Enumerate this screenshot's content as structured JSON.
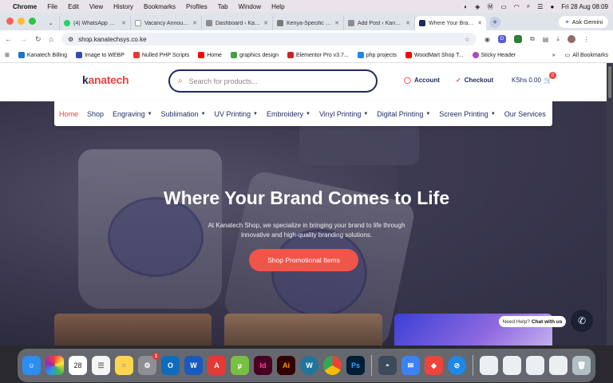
{
  "menubar": {
    "app": "Chrome",
    "items": [
      "File",
      "Edit",
      "View",
      "History",
      "Bookmarks",
      "Profiles",
      "Tab",
      "Window",
      "Help"
    ],
    "datetime": "Fri 28 Aug  08:09"
  },
  "tabs": [
    {
      "title": "(4) WhatsApp Busin",
      "color": "#25d366"
    },
    {
      "title": "Vacancy Announce",
      "color": "#ffffff"
    },
    {
      "title": "Dashboard ‹ Kanate",
      "color": "#8c8c8c"
    },
    {
      "title": "Kenya-Specific SEO",
      "color": "#7a7a7a"
    },
    {
      "title": "Add Post ‹ Kanatec",
      "color": "#8c8c8c"
    },
    {
      "title": "Where Your Brand C",
      "color": "#1f2a5c",
      "active": true
    }
  ],
  "gemini": "Ask Gemini",
  "toolbar": {
    "url": "shop.kanatechsys.co.ke"
  },
  "bookmarks": [
    {
      "label": "Kanatech Billing",
      "color": "#1976d2"
    },
    {
      "label": "Image to WEBP",
      "color": "#3949ab"
    },
    {
      "label": "Nulled PHP Scripts",
      "color": "#e53935"
    },
    {
      "label": "Home",
      "color": "#ff0000"
    },
    {
      "label": "graphics design",
      "color": "#43a047"
    },
    {
      "label": "Elementor Pro v3.7...",
      "color": "#c62828"
    },
    {
      "label": "php projects",
      "color": "#1e88e5"
    },
    {
      "label": "WoodMart Shop T...",
      "color": "#ff0000"
    },
    {
      "label": "Sticky Header",
      "color": "#ab47bc"
    }
  ],
  "bookmarks_all": "All Bookmarks",
  "site": {
    "logo_k": "k",
    "logo_rest": "anatech",
    "search_placeholder": "Search for products...",
    "account": "Account",
    "checkout": "Checkout",
    "cart_total": "KShs 0.00",
    "cart_count": "0"
  },
  "nav": [
    {
      "label": "Home",
      "active": true,
      "dropdown": false
    },
    {
      "label": "Shop",
      "dropdown": false
    },
    {
      "label": "Engraving",
      "dropdown": true
    },
    {
      "label": "Sublimation",
      "dropdown": true
    },
    {
      "label": "UV Printing",
      "dropdown": true
    },
    {
      "label": "Embroidery",
      "dropdown": true
    },
    {
      "label": "Vinyl Printing",
      "dropdown": true
    },
    {
      "label": "Digital Printing",
      "dropdown": true
    },
    {
      "label": "Screen Printing",
      "dropdown": true
    },
    {
      "label": "Our Services",
      "dropdown": false
    }
  ],
  "hero": {
    "title": "Where Your Brand Comes to Life",
    "subtitle": "At Kanatech Shop, we specialize in bringing your brand to life through innovative and high-quality branding solutions.",
    "cta": "Shop Promotional Items"
  },
  "chat": {
    "prefix": "Need Help?",
    "action": "Chat with us"
  },
  "dock": {
    "calendar_day": "28",
    "settings_badge": "1",
    "apps": [
      {
        "name": "finder",
        "label": "",
        "color": "#2b8ef0"
      },
      {
        "name": "photos",
        "label": "",
        "color": "#f4b400"
      },
      {
        "name": "calendar",
        "label": "28",
        "color": "#ffffff"
      },
      {
        "name": "reminders",
        "label": "",
        "color": "#f5f5f5"
      },
      {
        "name": "notes",
        "label": "",
        "color": "#ffd54f"
      },
      {
        "name": "settings",
        "label": "",
        "color": "#8e8e93"
      },
      {
        "name": "outlook",
        "label": "O",
        "color": "#0f6cbd"
      },
      {
        "name": "word",
        "label": "W",
        "color": "#185abd"
      },
      {
        "name": "acrobat",
        "label": "A",
        "color": "#e53935"
      },
      {
        "name": "utorrent",
        "label": "µ",
        "color": "#78c043"
      },
      {
        "name": "indesign",
        "label": "Id",
        "color": "#49021f"
      },
      {
        "name": "illustrator",
        "label": "Ai",
        "color": "#330000"
      },
      {
        "name": "wordpress",
        "label": "W",
        "color": "#21759b"
      },
      {
        "name": "chrome",
        "label": "",
        "color": "#f0f0f0"
      },
      {
        "name": "photoshop",
        "label": "Ps",
        "color": "#001e36"
      },
      {
        "name": "vpn",
        "label": "",
        "color": "#3d4a5c"
      },
      {
        "name": "mail",
        "label": "",
        "color": "#3b82f6"
      },
      {
        "name": "anydesk",
        "label": "",
        "color": "#ef443b"
      },
      {
        "name": "safari",
        "label": "",
        "color": "#1e88e5"
      }
    ]
  }
}
